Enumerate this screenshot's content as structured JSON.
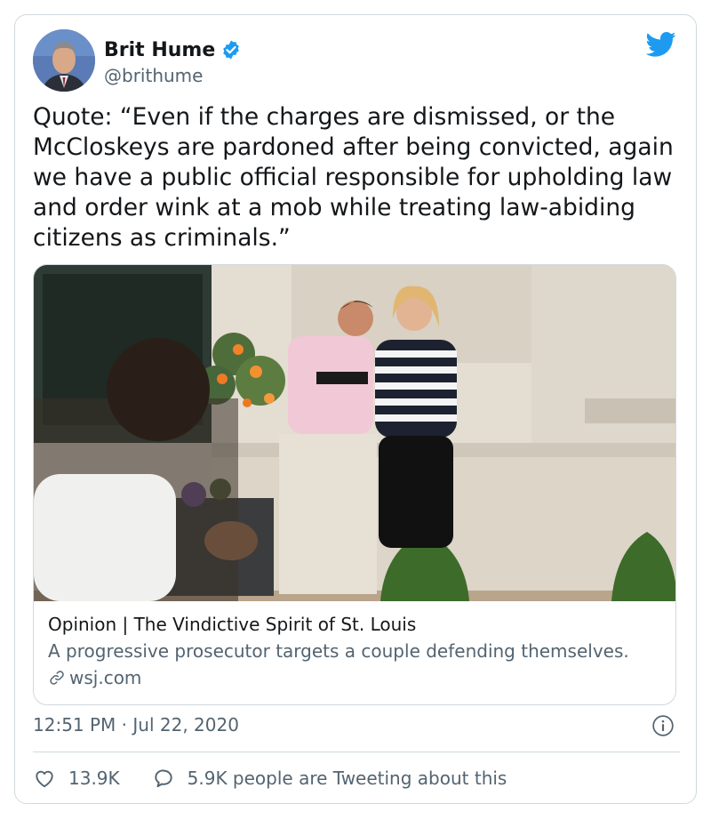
{
  "tweet": {
    "display_name": "Brit Hume",
    "handle": "@brithume",
    "text": "Quote: “Even if the charges are dismissed, or the McCloskeys are pardoned after being convicted, again we have a public official responsible for upholding law and order wink at a mob while treating law-abiding citizens as criminals.”",
    "timestamp": "12:51 PM · Jul 22, 2020",
    "icons": {
      "verified": "verified-badge-icon",
      "brand": "twitter-bird-icon",
      "info": "info-icon",
      "like": "heart-icon",
      "reply": "speech-bubble-icon",
      "link": "link-icon"
    },
    "colors": {
      "accent": "#1d9bf0",
      "secondary_text": "#536471",
      "border": "#cfd9de"
    }
  },
  "link_card": {
    "title": "Opinion | The Vindictive Spirit of St. Louis",
    "description": "A progressive prosecutor targets a couple defending themselves.",
    "domain": "wsj.com"
  },
  "actions": {
    "likes": "13.9K",
    "tweeting": "5.9K people are Tweeting about this"
  }
}
